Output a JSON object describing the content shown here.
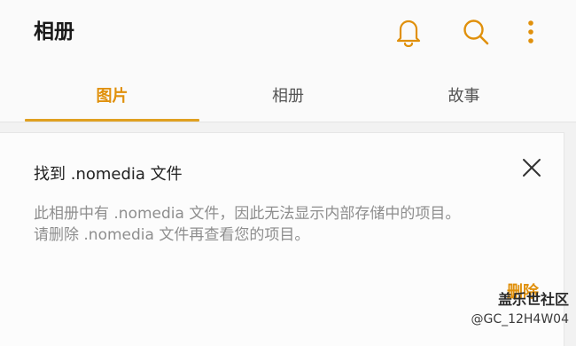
{
  "appbar": {
    "title": "相册",
    "icons": [
      "bell-icon",
      "search-icon",
      "more-vertical-icon"
    ]
  },
  "tabs": [
    {
      "label": "图片",
      "active": true
    },
    {
      "label": "相册",
      "active": false
    },
    {
      "label": "故事",
      "active": false
    }
  ],
  "notice_card": {
    "title": "找到 .nomedia 文件",
    "message_lines": [
      "此相册中有 .nomedia 文件，因此无法显示内部存储中的项目。",
      "请删除 .nomedia 文件再查看您的项目。"
    ],
    "delete_label": "删除"
  },
  "watermark": {
    "logo_text": "盖乐世社区",
    "user_text": "@GC_12H4W04"
  },
  "colors": {
    "accent": "#e0900b",
    "text_primary": "#1a1a1a",
    "text_secondary": "#8e8e8e",
    "background": "#f2f2f2"
  }
}
